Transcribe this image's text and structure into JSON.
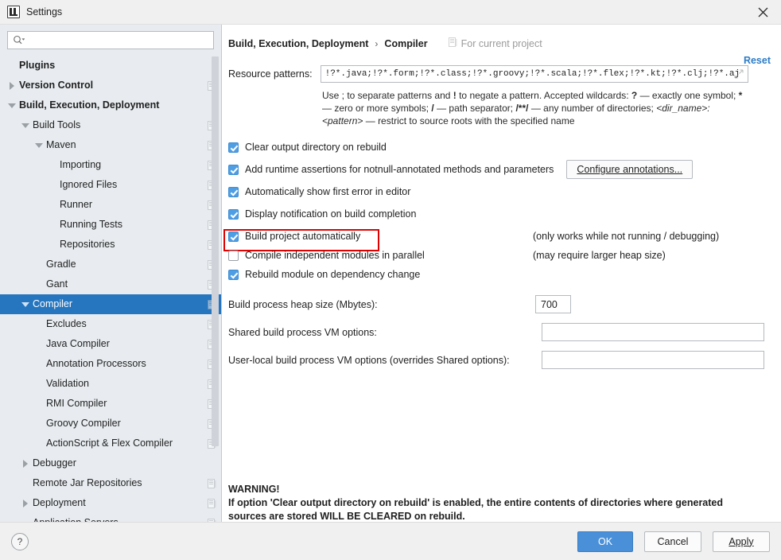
{
  "window": {
    "title": "Settings",
    "app_icon": "intellij-idea-icon",
    "close_icon": "close-icon"
  },
  "sidebar": {
    "search": {
      "placeholder": "",
      "value": "",
      "icon": "search-icon"
    },
    "items": [
      {
        "label": "Plugins",
        "indent": 0,
        "twisty": "none",
        "bold": true,
        "selected": false,
        "project_icon": false
      },
      {
        "label": "Version Control",
        "indent": 0,
        "twisty": "right",
        "bold": true,
        "selected": false,
        "project_icon": true
      },
      {
        "label": "Build, Execution, Deployment",
        "indent": 0,
        "twisty": "down",
        "bold": true,
        "selected": false,
        "project_icon": false
      },
      {
        "label": "Build Tools",
        "indent": 1,
        "twisty": "down",
        "bold": false,
        "selected": false,
        "project_icon": true
      },
      {
        "label": "Maven",
        "indent": 2,
        "twisty": "down",
        "bold": false,
        "selected": false,
        "project_icon": true
      },
      {
        "label": "Importing",
        "indent": 3,
        "twisty": "none",
        "bold": false,
        "selected": false,
        "project_icon": true
      },
      {
        "label": "Ignored Files",
        "indent": 3,
        "twisty": "none",
        "bold": false,
        "selected": false,
        "project_icon": true
      },
      {
        "label": "Runner",
        "indent": 3,
        "twisty": "none",
        "bold": false,
        "selected": false,
        "project_icon": true
      },
      {
        "label": "Running Tests",
        "indent": 3,
        "twisty": "none",
        "bold": false,
        "selected": false,
        "project_icon": true
      },
      {
        "label": "Repositories",
        "indent": 3,
        "twisty": "none",
        "bold": false,
        "selected": false,
        "project_icon": true
      },
      {
        "label": "Gradle",
        "indent": 2,
        "twisty": "none",
        "bold": false,
        "selected": false,
        "project_icon": true
      },
      {
        "label": "Gant",
        "indent": 2,
        "twisty": "none",
        "bold": false,
        "selected": false,
        "project_icon": true
      },
      {
        "label": "Compiler",
        "indent": 1,
        "twisty": "down",
        "bold": false,
        "selected": true,
        "project_icon": true
      },
      {
        "label": "Excludes",
        "indent": 2,
        "twisty": "none",
        "bold": false,
        "selected": false,
        "project_icon": true
      },
      {
        "label": "Java Compiler",
        "indent": 2,
        "twisty": "none",
        "bold": false,
        "selected": false,
        "project_icon": true
      },
      {
        "label": "Annotation Processors",
        "indent": 2,
        "twisty": "none",
        "bold": false,
        "selected": false,
        "project_icon": true
      },
      {
        "label": "Validation",
        "indent": 2,
        "twisty": "none",
        "bold": false,
        "selected": false,
        "project_icon": true
      },
      {
        "label": "RMI Compiler",
        "indent": 2,
        "twisty": "none",
        "bold": false,
        "selected": false,
        "project_icon": true
      },
      {
        "label": "Groovy Compiler",
        "indent": 2,
        "twisty": "none",
        "bold": false,
        "selected": false,
        "project_icon": true
      },
      {
        "label": "ActionScript & Flex Compiler",
        "indent": 2,
        "twisty": "none",
        "bold": false,
        "selected": false,
        "project_icon": true
      },
      {
        "label": "Debugger",
        "indent": 1,
        "twisty": "right",
        "bold": false,
        "selected": false,
        "project_icon": false
      },
      {
        "label": "Remote Jar Repositories",
        "indent": 1,
        "twisty": "none",
        "bold": false,
        "selected": false,
        "project_icon": true
      },
      {
        "label": "Deployment",
        "indent": 1,
        "twisty": "right",
        "bold": false,
        "selected": false,
        "project_icon": true
      },
      {
        "label": "Application Servers",
        "indent": 1,
        "twisty": "none",
        "bold": false,
        "selected": false,
        "project_icon": true
      }
    ]
  },
  "header": {
    "breadcrumb_root": "Build, Execution, Deployment",
    "breadcrumb_sep": "›",
    "breadcrumb_leaf": "Compiler",
    "scope_label": "For current project",
    "scope_icon": "project-scope-icon",
    "reset_label": "Reset"
  },
  "resource_patterns": {
    "label": "Resource patterns:",
    "value": "!?*.java;!?*.form;!?*.class;!?*.groovy;!?*.scala;!?*.flex;!?*.kt;!?*.clj;!?*.aj",
    "expand_icon": "expand-icon",
    "hint_line1_a": "Use ; to separate patterns and ",
    "hint_bang": "!",
    "hint_line1_b": " to negate a pattern. Accepted wildcards: ",
    "hint_q": "?",
    "hint_line1_c": " — exactly one symbol; ",
    "hint_star": "*",
    "hint_line1_d": " —",
    "hint_line2_a": "zero or more symbols; ",
    "hint_slash": "/",
    "hint_line2_b": " — path separator; ",
    "hint_dstar": "/**/",
    "hint_line2_c": " — any number of directories; ",
    "hint_dir": "<dir_name>",
    "hint_colon": ": ",
    "hint_pat": "<pattern>",
    "hint_line2_d": " —",
    "hint_line3": "restrict to source roots with the specified name"
  },
  "options": [
    {
      "label": "Clear output directory on rebuild",
      "checked": true,
      "note": "",
      "highlighted": false,
      "button": ""
    },
    {
      "label": "Add runtime assertions for notnull-annotated methods and parameters",
      "checked": true,
      "note": "",
      "highlighted": false,
      "button": "Configure annotations..."
    },
    {
      "label": "Automatically show first error in editor",
      "checked": true,
      "note": "",
      "highlighted": false,
      "button": ""
    },
    {
      "label": "Display notification on build completion",
      "checked": true,
      "note": "",
      "highlighted": false,
      "button": ""
    },
    {
      "label": "Build project automatically",
      "checked": true,
      "note": "(only works while not running / debugging)",
      "highlighted": true,
      "button": ""
    },
    {
      "label": "Compile independent modules in parallel",
      "checked": false,
      "note": "(may require larger heap size)",
      "highlighted": false,
      "button": ""
    },
    {
      "label": "Rebuild module on dependency change",
      "checked": true,
      "note": "",
      "highlighted": false,
      "button": ""
    }
  ],
  "fields": {
    "heap_label": "Build process heap size (Mbytes):",
    "heap_value": "700",
    "shared_vm_label": "Shared build process VM options:",
    "shared_vm_value": "",
    "userlocal_vm_label": "User-local build process VM options (overrides Shared options):",
    "userlocal_vm_value": ""
  },
  "warning": {
    "title": "WARNING!",
    "line1": "If option 'Clear output directory on rebuild' is enabled, the entire contents of directories where generated",
    "line2": "sources are stored WILL BE CLEARED on rebuild."
  },
  "footer": {
    "help_label": "?",
    "ok_label": "OK",
    "cancel_label": "Cancel",
    "apply_label": "Apply"
  },
  "colors": {
    "accent": "#2675bf",
    "primary_button": "#4a90d9",
    "link": "#2e7dc7",
    "highlight_box": "#e00000",
    "checkbox_on": "#4f9ee3",
    "sidebar_bg": "#e8ecf0"
  }
}
